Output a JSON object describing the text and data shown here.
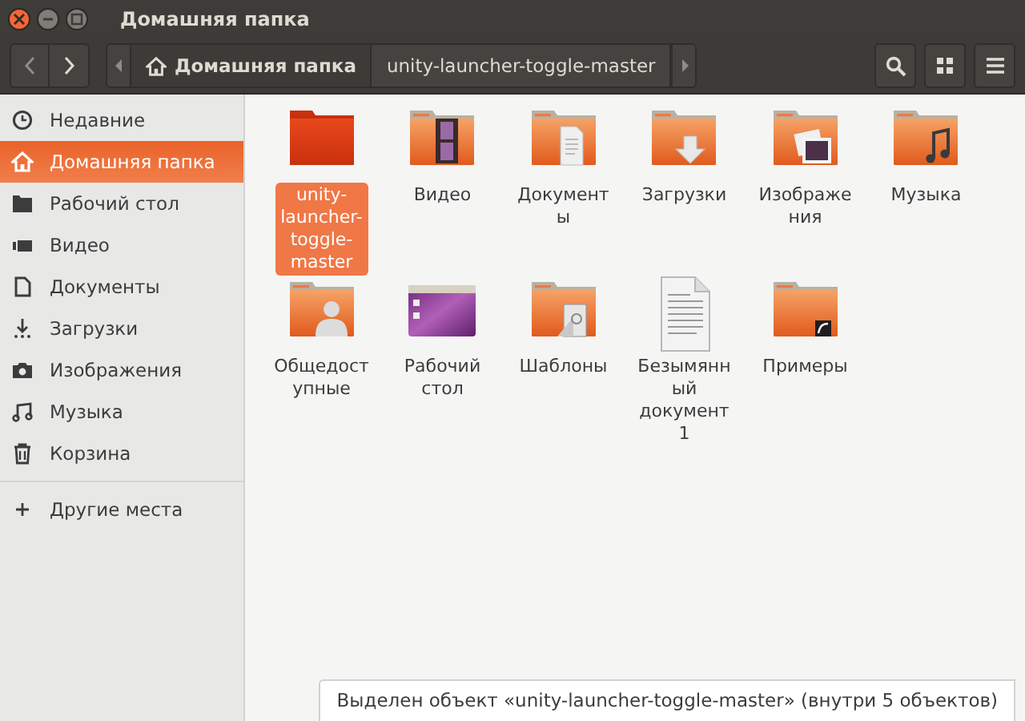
{
  "window": {
    "title": "Домашняя папка"
  },
  "path_bar": [
    {
      "label": "Домашняя папка",
      "kind": "home",
      "selected": true
    },
    {
      "label": "unity-launcher-toggle-master",
      "kind": "folder",
      "selected": false
    }
  ],
  "sidebar": {
    "items": [
      {
        "label": "Недавние",
        "kind": "recent",
        "selected": false
      },
      {
        "label": "Домашняя папка",
        "kind": "home",
        "selected": true
      },
      {
        "label": "Рабочий стол",
        "kind": "desktop",
        "selected": false
      },
      {
        "label": "Видео",
        "kind": "video",
        "selected": false
      },
      {
        "label": "Документы",
        "kind": "documents",
        "selected": false
      },
      {
        "label": "Загрузки",
        "kind": "downloads",
        "selected": false
      },
      {
        "label": "Изображения",
        "kind": "pictures",
        "selected": false
      },
      {
        "label": "Музыка",
        "kind": "music",
        "selected": false
      },
      {
        "label": "Корзина",
        "kind": "trash",
        "selected": false
      }
    ],
    "other_places": {
      "label": "Другие места"
    }
  },
  "files": [
    {
      "name": "unity-launcher-toggle-master",
      "kind": "plain",
      "selected": true
    },
    {
      "name": "Видео",
      "kind": "video",
      "selected": false
    },
    {
      "name": "Документы",
      "kind": "documents",
      "selected": false
    },
    {
      "name": "Загрузки",
      "kind": "downloads",
      "selected": false
    },
    {
      "name": "Изображения",
      "kind": "pictures",
      "selected": false
    },
    {
      "name": "Музыка",
      "kind": "music",
      "selected": false
    },
    {
      "name": "Общедоступные",
      "kind": "public",
      "selected": false
    },
    {
      "name": "Рабочий стол",
      "kind": "desktop",
      "selected": false
    },
    {
      "name": "Шаблоны",
      "kind": "templates",
      "selected": false
    },
    {
      "name": "Безымянный документ 1",
      "kind": "document",
      "selected": false
    },
    {
      "name": "Примеры",
      "kind": "examples",
      "selected": false
    }
  ],
  "status": "Выделен объект «unity-launcher-toggle-master»  (внутри 5 объектов)"
}
